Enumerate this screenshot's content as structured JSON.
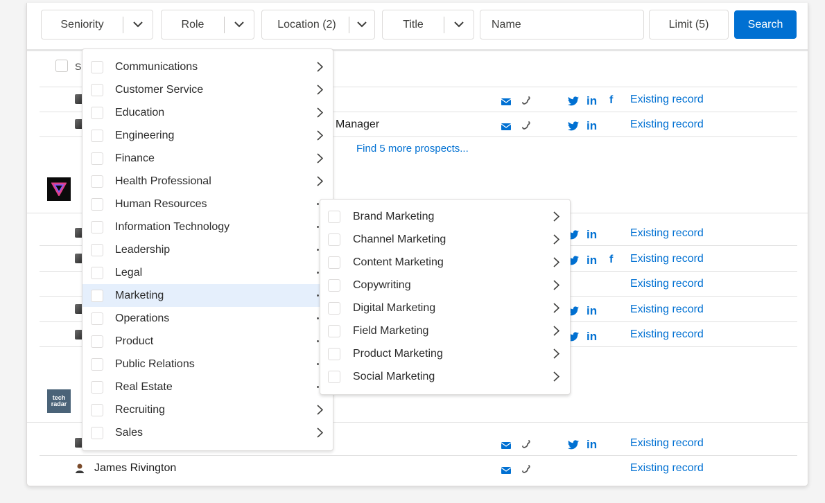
{
  "filters": {
    "seniority": "Seniority",
    "role": "Role",
    "location": "Location (2)",
    "title": "Title",
    "name_placeholder": "Name",
    "limit": "Limit (5)",
    "search_label": "Search"
  },
  "table": {
    "select_all_label": "S",
    "rows": [
      {
        "name": "",
        "title": "",
        "status": "Existing record"
      },
      {
        "name": "",
        "title": "Manager",
        "status": "Existing record"
      },
      {
        "name": "",
        "title": "",
        "status": "Existing record"
      },
      {
        "name": "",
        "title": "",
        "status": "Existing record"
      },
      {
        "name": "",
        "title": "",
        "status": "Existing record"
      },
      {
        "name": "",
        "title": "",
        "status": "Existing record"
      },
      {
        "name": "",
        "title": "",
        "status": "Existing record"
      },
      {
        "name": "",
        "title": "",
        "status": "Existing record"
      },
      {
        "name": "James Rivington",
        "title": "",
        "status": "Existing record"
      }
    ],
    "find_more": "Find 5 more prospects...",
    "logo_text": [
      "tech",
      "radar"
    ]
  },
  "role_menu": {
    "items": [
      {
        "label": "Communications",
        "marker": "arrow"
      },
      {
        "label": "Customer Service",
        "marker": "arrow"
      },
      {
        "label": "Education",
        "marker": "arrow"
      },
      {
        "label": "Engineering",
        "marker": "arrow"
      },
      {
        "label": "Finance",
        "marker": "arrow"
      },
      {
        "label": "Health Professional",
        "marker": "arrow"
      },
      {
        "label": "Human Resources",
        "marker": "dots"
      },
      {
        "label": "Information Technology",
        "marker": "dots"
      },
      {
        "label": "Leadership",
        "marker": "dots"
      },
      {
        "label": "Legal",
        "marker": "dots"
      },
      {
        "label": "Marketing",
        "marker": "dots",
        "active": true
      },
      {
        "label": "Operations",
        "marker": "dots"
      },
      {
        "label": "Product",
        "marker": "dots"
      },
      {
        "label": "Public Relations",
        "marker": "dots"
      },
      {
        "label": "Real Estate",
        "marker": "dots"
      },
      {
        "label": "Recruiting",
        "marker": "arrow"
      },
      {
        "label": "Sales",
        "marker": "arrow"
      }
    ]
  },
  "marketing_submenu": {
    "items": [
      "Brand Marketing",
      "Channel Marketing",
      "Content Marketing",
      "Copywriting",
      "Digital Marketing",
      "Field Marketing",
      "Product Marketing",
      "Social Marketing"
    ]
  },
  "colors": {
    "accent": "#0070d2",
    "active_row": "#e5effc"
  }
}
